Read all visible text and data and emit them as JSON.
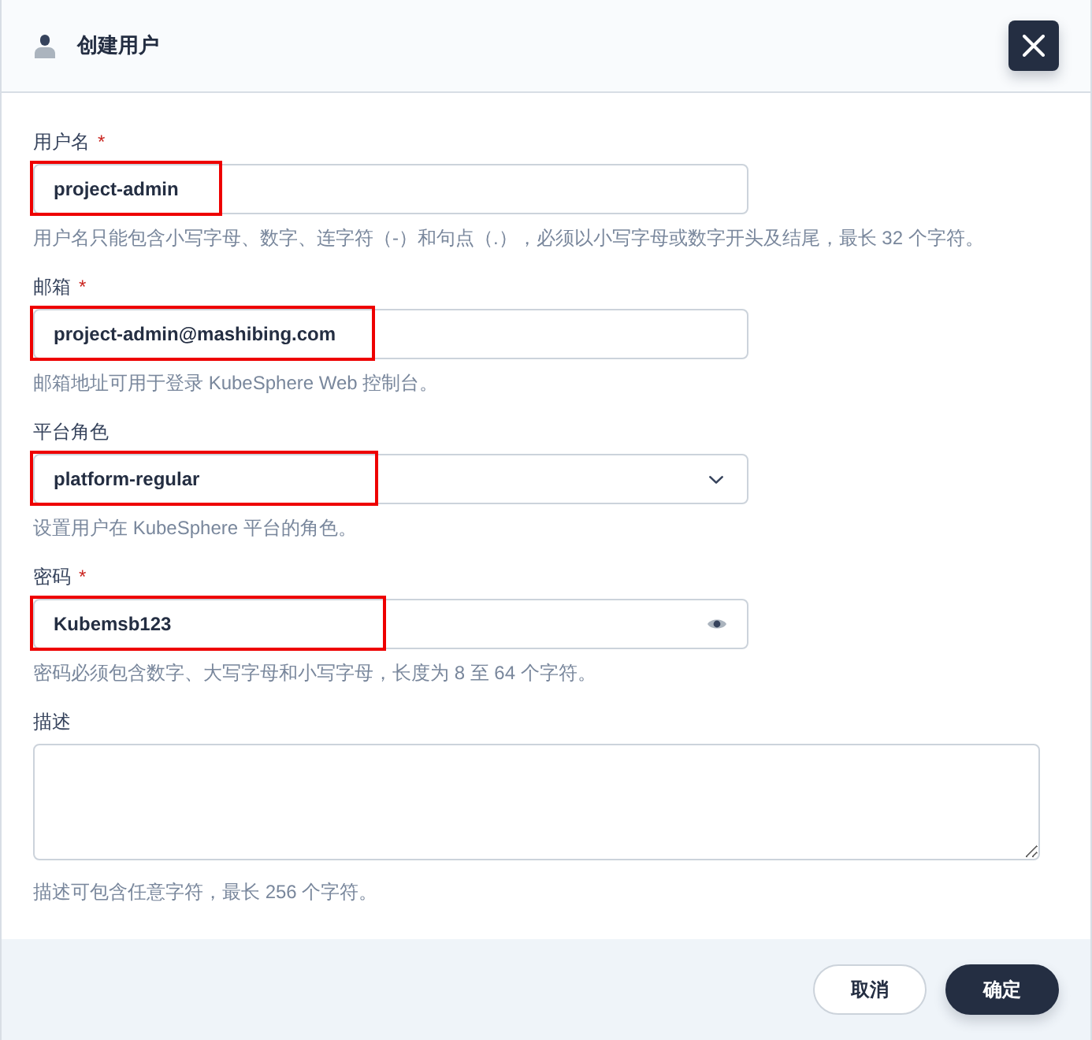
{
  "dialog": {
    "title": "创建用户"
  },
  "fields": [
    {
      "kind": "text",
      "label": "用户名",
      "required_mark": "*",
      "value": "project-admin",
      "hint": "用户名只能包含小写字母、数字、连字符（-）和句点（.），必须以小写字母或数字开头及结尾，最长 32 个字符。",
      "highlighted": true
    },
    {
      "kind": "text",
      "label": "邮箱",
      "required_mark": "*",
      "value": "project-admin@mashibing.com",
      "hint": "邮箱地址可用于登录 KubeSphere Web 控制台。",
      "highlighted": true
    },
    {
      "kind": "select",
      "label": "平台角色",
      "value": "platform-regular",
      "hint": "设置用户在 KubeSphere 平台的角色。",
      "highlighted": true
    },
    {
      "kind": "password",
      "label": "密码",
      "required_mark": "*",
      "value": "Kubemsb123",
      "hint": "密码必须包含数字、大写字母和小写字母，长度为 8 至 64 个字符。",
      "highlighted": true
    },
    {
      "kind": "textarea",
      "label": "描述",
      "hint": "描述可包含任意字符，最长 256 个字符。"
    }
  ],
  "footer": {
    "buttons": [
      {
        "label": "取消",
        "kind": "secondary"
      },
      {
        "label": "确定",
        "kind": "primary"
      }
    ]
  }
}
